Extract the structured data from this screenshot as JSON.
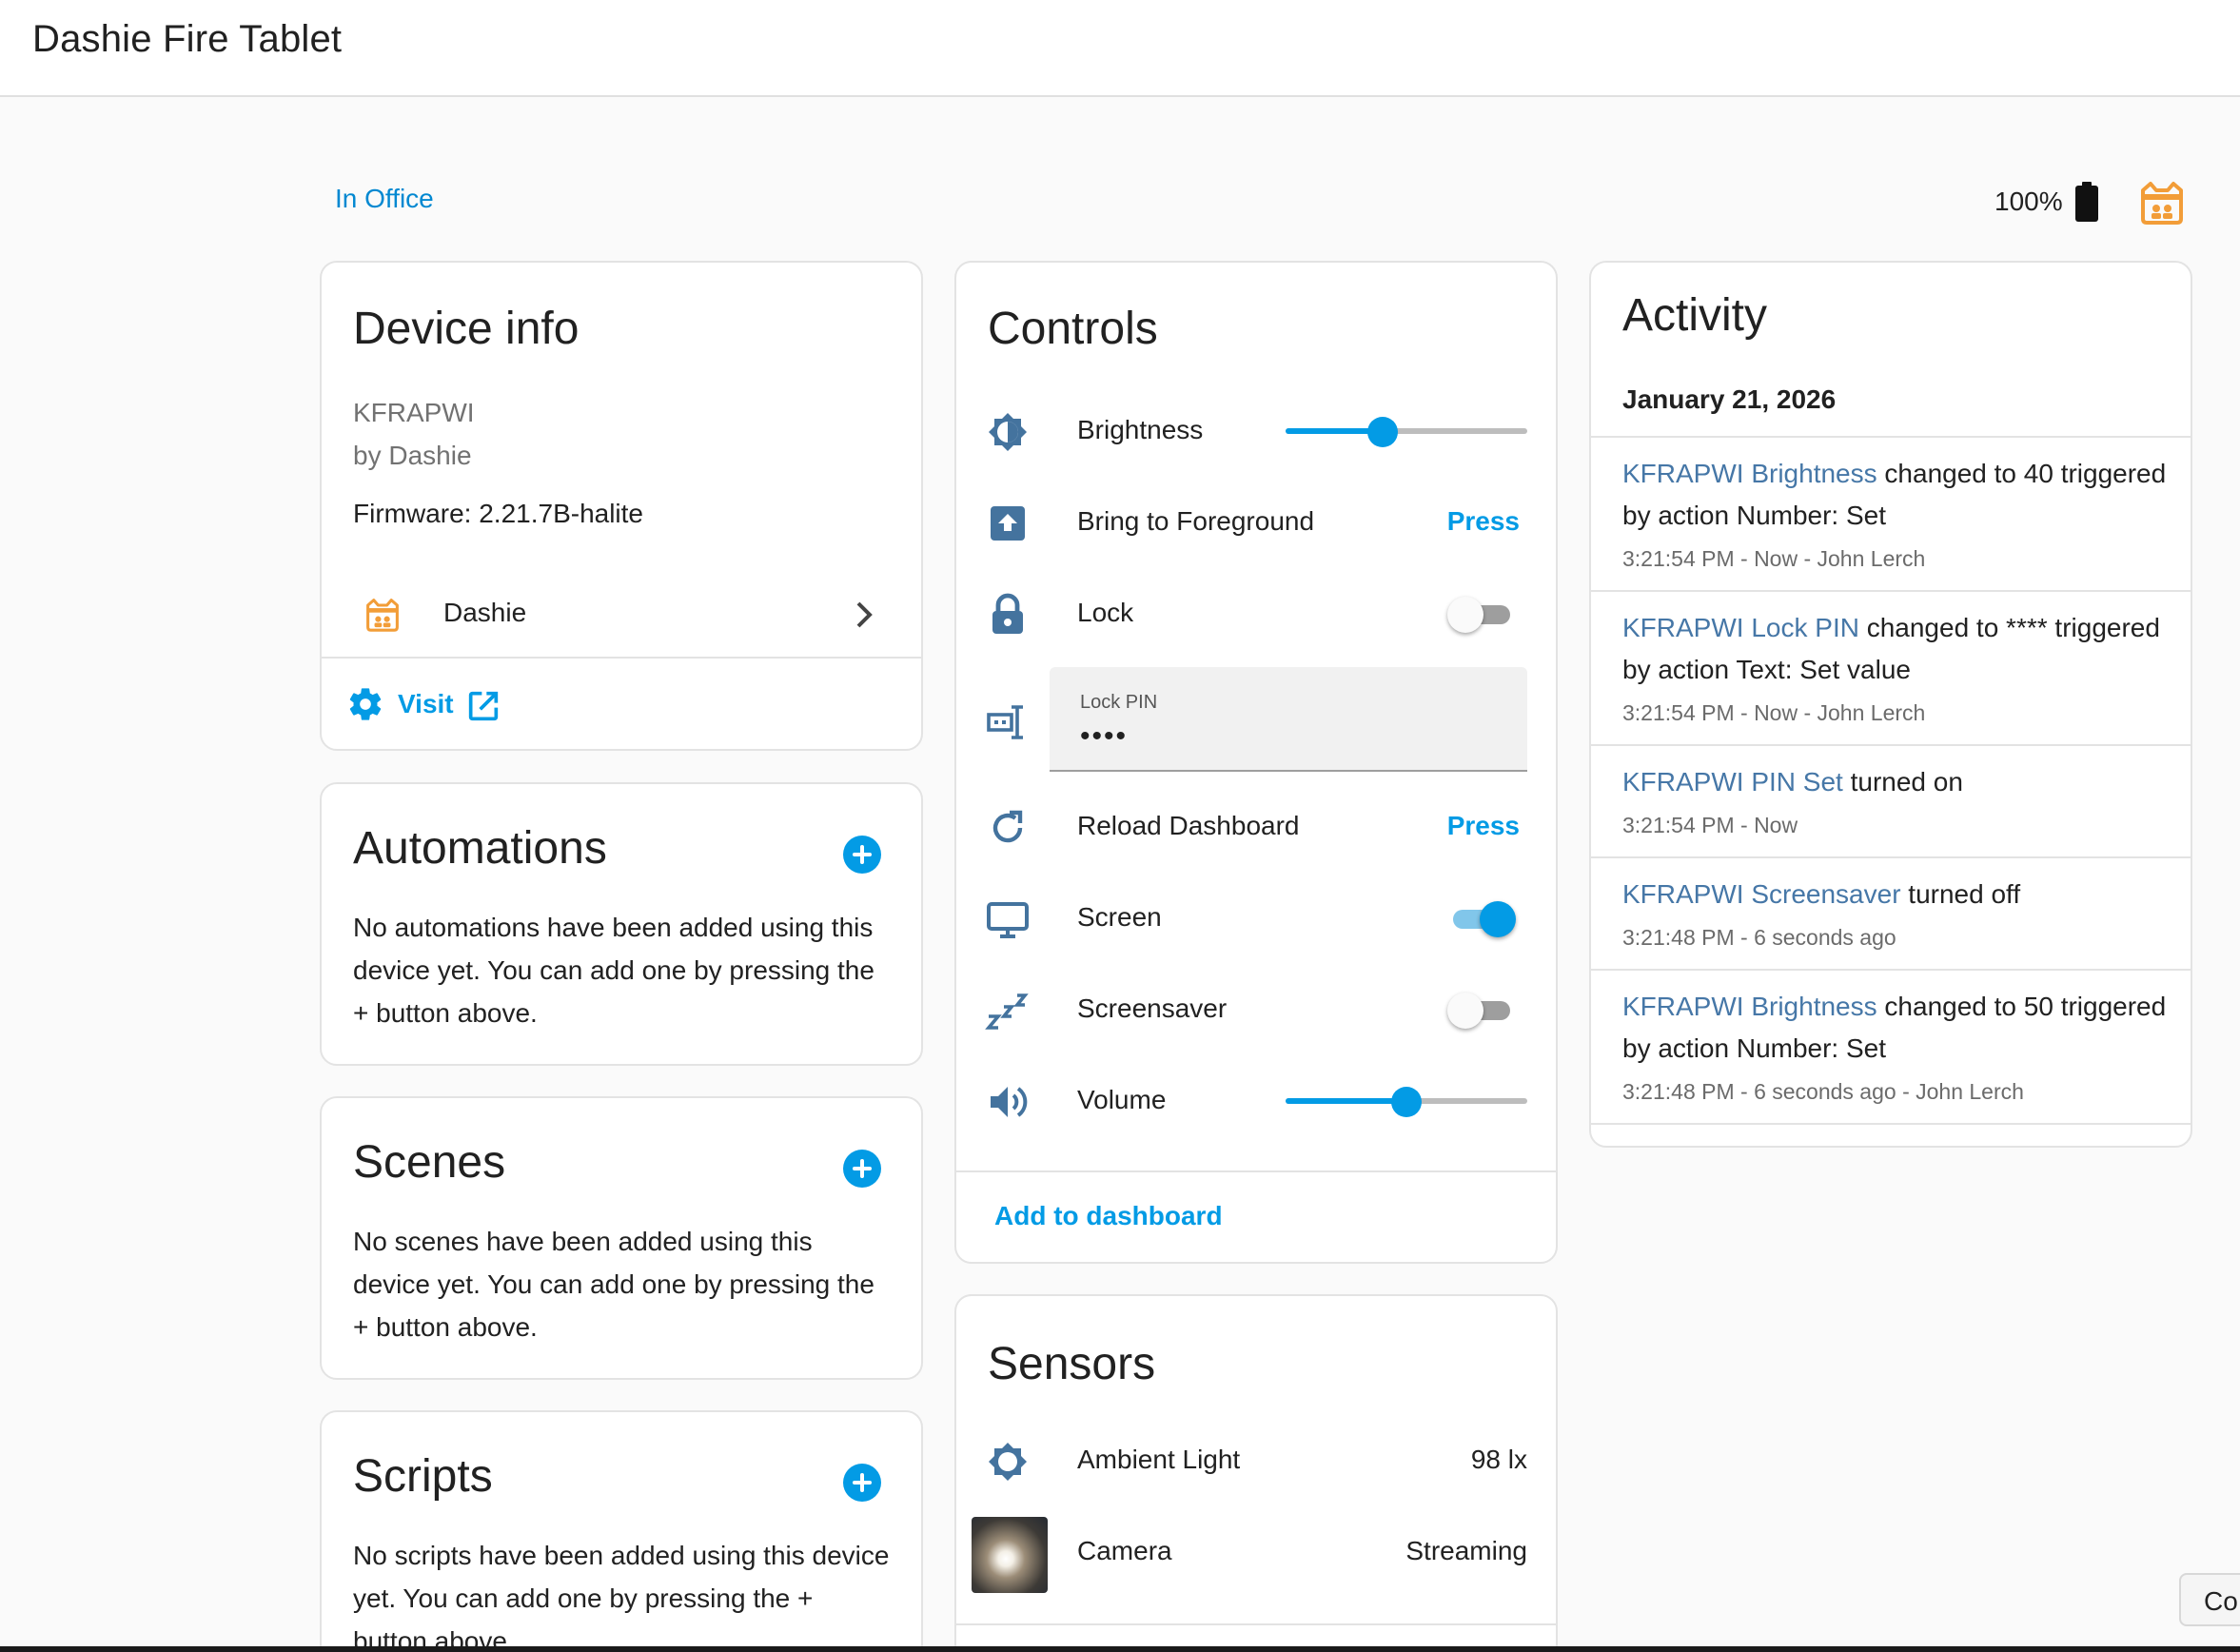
{
  "topbar": {
    "title": "Dashie Fire Tablet"
  },
  "header": {
    "area": "In Office",
    "battery": "100%",
    "logo_icon": "dashie-logo-icon"
  },
  "device_info": {
    "title": "Device info",
    "model": "KFRAPWI",
    "manufacturer": "by Dashie",
    "firmware": "Firmware: 2.21.7B-halite",
    "integration": "Dashie",
    "visit": "Visit"
  },
  "automations": {
    "title": "Automations",
    "empty": "No automations have been added using this device yet. You can add one by pressing the + button above."
  },
  "scenes": {
    "title": "Scenes",
    "empty": "No scenes have been added using this device yet. You can add one by pressing the + button above."
  },
  "scripts": {
    "title": "Scripts",
    "empty": "No scripts have been added using this device yet. You can add one by pressing the + button above."
  },
  "controls": {
    "title": "Controls",
    "brightness": {
      "label": "Brightness",
      "value_pct": 40,
      "icon": "brightness-icon"
    },
    "foreground": {
      "label": "Bring to Foreground",
      "action": "Press",
      "icon": "foreground-icon"
    },
    "lock": {
      "label": "Lock",
      "state": "off",
      "icon": "lock-icon"
    },
    "lock_pin": {
      "label": "Lock PIN",
      "value": "••••",
      "icon": "pin-icon"
    },
    "reload": {
      "label": "Reload Dashboard",
      "action": "Press",
      "icon": "reload-icon"
    },
    "screen": {
      "label": "Screen",
      "state": "on",
      "icon": "monitor-icon"
    },
    "screensaver": {
      "label": "Screensaver",
      "state": "off",
      "icon": "sleep-icon"
    },
    "volume": {
      "label": "Volume",
      "value_pct": 50,
      "icon": "volume-icon"
    },
    "add_to_dashboard": "Add to dashboard"
  },
  "sensors": {
    "title": "Sensors",
    "ambient": {
      "label": "Ambient Light",
      "value": "98 lx",
      "icon": "light-sensor-icon"
    },
    "camera": {
      "label": "Camera",
      "value": "Streaming"
    }
  },
  "activity": {
    "title": "Activity",
    "date": "January 21, 2026",
    "items": [
      {
        "entity": "KFRAPWI Brightness",
        "text_1": " changed to 40 triggered",
        "text_2": "by action Number: Set",
        "meta": "3:21:54 PM - Now - John Lerch"
      },
      {
        "entity": "KFRAPWI Lock PIN",
        "text_1": " changed to **** triggered",
        "text_2": "by action Text: Set value",
        "meta": "3:21:54 PM - Now - John Lerch"
      },
      {
        "entity": "KFRAPWI PIN Set",
        "text_1": " turned on",
        "text_2": "",
        "meta": "3:21:54 PM - Now"
      },
      {
        "entity": "KFRAPWI Screensaver",
        "text_1": " turned off",
        "text_2": "",
        "meta": "3:21:48 PM - 6 seconds ago"
      },
      {
        "entity": "KFRAPWI Brightness",
        "text_1": " changed to 50 triggered",
        "text_2": "by action Number: Set",
        "meta": "3:21:48 PM - 6 seconds ago - John Lerch"
      }
    ]
  },
  "overlay": {
    "partial_button": "Co"
  },
  "colors": {
    "accent": "#039be5",
    "link": "#4677a7",
    "icon": "#44739e",
    "logo": "#f29d38"
  }
}
